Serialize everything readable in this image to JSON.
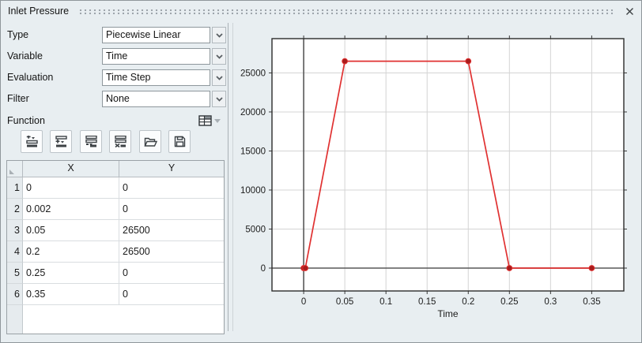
{
  "window": {
    "title": "Inlet Pressure",
    "close_icon": "close-icon"
  },
  "form": {
    "fields": [
      {
        "label": "Type",
        "value": "Piecewise Linear"
      },
      {
        "label": "Variable",
        "value": "Time"
      },
      {
        "label": "Evaluation",
        "value": "Time Step"
      },
      {
        "label": "Filter",
        "value": "None"
      }
    ]
  },
  "function_section": {
    "label": "Function",
    "view_icon": "table-grid-icon",
    "toolbar_icons": [
      "insert-row-above-icon",
      "insert-row-icon",
      "insert-row-below-icon",
      "delete-row-icon",
      "open-folder-icon",
      "save-icon"
    ]
  },
  "table": {
    "columns": [
      "X",
      "Y"
    ],
    "row_numbers": [
      "1",
      "2",
      "3",
      "4",
      "5",
      "6"
    ],
    "rows": [
      [
        "0",
        "0"
      ],
      [
        "0.002",
        "0"
      ],
      [
        "0.05",
        "26500"
      ],
      [
        "0.2",
        "26500"
      ],
      [
        "0.25",
        "0"
      ],
      [
        "0.35",
        "0"
      ]
    ]
  },
  "chart_data": {
    "type": "line",
    "title": "",
    "xlabel": "Time",
    "ylabel": "",
    "x": [
      0,
      0.002,
      0.05,
      0.2,
      0.25,
      0.35
    ],
    "series": [
      {
        "name": "Inlet Pressure",
        "values": [
          0,
          0,
          26500,
          26500,
          0,
          0
        ]
      }
    ],
    "xlim": [
      -0.0385,
      0.389
    ],
    "ylim": [
      -2930,
      29390
    ],
    "xticks": [
      0,
      0.05,
      0.1,
      0.15,
      0.2,
      0.25,
      0.3,
      0.35
    ],
    "yticks": [
      0,
      5000,
      10000,
      15000,
      20000,
      25000
    ],
    "grid": true,
    "legend": "none",
    "line_color": "#e03131",
    "marker_color": "#a81c1c",
    "zero_axis_color": "#585858",
    "grid_color": "#d4d4d4",
    "border_color": "#2b2b2b"
  },
  "colors": {
    "panel_bg": "#e8eef1",
    "accent_red": "#e03131",
    "window_border": "#8f969b"
  }
}
